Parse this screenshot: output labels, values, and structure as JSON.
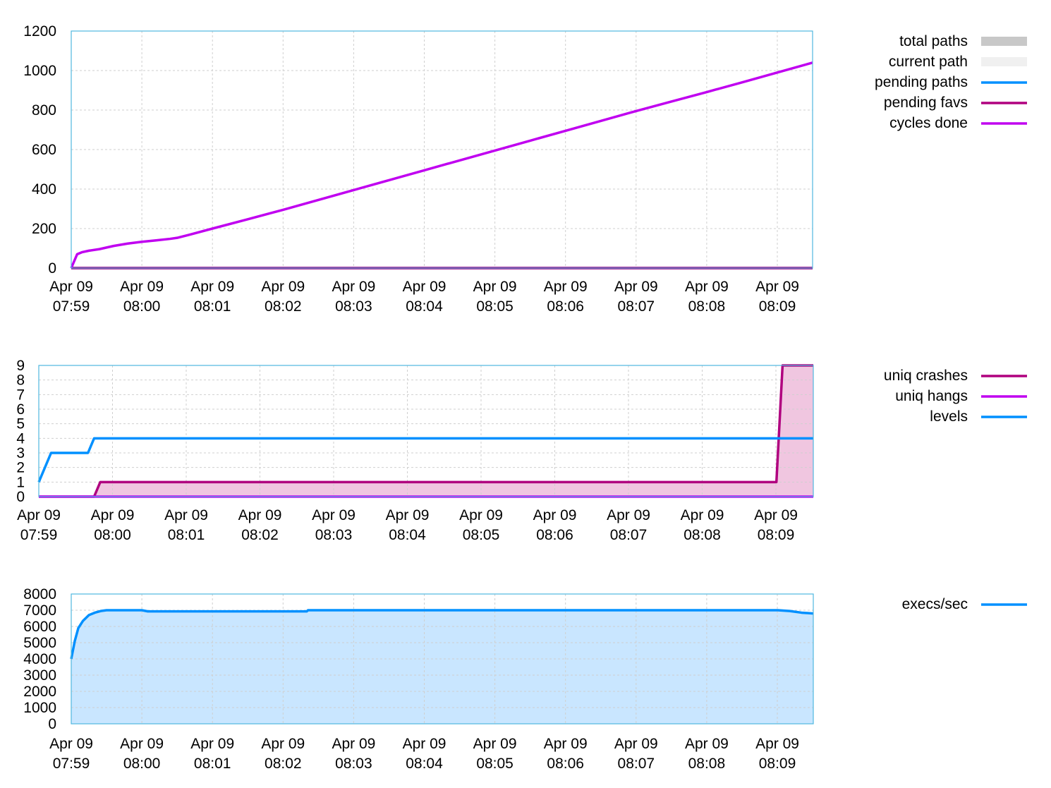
{
  "colors": {
    "frame": "#4fb8e0",
    "grid": "#cfcfcf",
    "total_paths": "#c8c8c8",
    "current_path": "#f0f0f0",
    "pending_paths": "#0090ff",
    "pending_favs": "#b0007f",
    "cycles_done": "#c000f0",
    "crash_fill": "#f0c6e0",
    "exec_fill": "#c9e6ff"
  },
  "chart_data": [
    {
      "type": "line",
      "title": "",
      "xlabel": "",
      "ylabel": "",
      "ylim": [
        0,
        1200
      ],
      "yticks": [
        "0",
        "200",
        "400",
        "600",
        "800",
        "1000",
        "1200"
      ],
      "xlim": [
        0,
        630
      ],
      "xticks": [
        {
          "date": "Apr 09",
          "time": "07:59"
        },
        {
          "date": "Apr 09",
          "time": "08:00"
        },
        {
          "date": "Apr 09",
          "time": "08:01"
        },
        {
          "date": "Apr 09",
          "time": "08:02"
        },
        {
          "date": "Apr 09",
          "time": "08:03"
        },
        {
          "date": "Apr 09",
          "time": "08:04"
        },
        {
          "date": "Apr 09",
          "time": "08:05"
        },
        {
          "date": "Apr 09",
          "time": "08:06"
        },
        {
          "date": "Apr 09",
          "time": "08:07"
        },
        {
          "date": "Apr 09",
          "time": "08:08"
        },
        {
          "date": "Apr 09",
          "time": "08:09"
        }
      ],
      "grid": true,
      "legend": "right",
      "series": [
        {
          "name": "total paths",
          "color_key": "total_paths",
          "x": [
            0,
            630
          ],
          "y": [
            0,
            0
          ]
        },
        {
          "name": "current path",
          "color_key": "current_path",
          "x": [
            0,
            630
          ],
          "y": [
            0,
            0
          ]
        },
        {
          "name": "pending paths",
          "color_key": "pending_paths",
          "x": [
            0,
            630
          ],
          "y": [
            0,
            0
          ]
        },
        {
          "name": "pending favs",
          "color_key": "pending_favs",
          "x": [
            0,
            630
          ],
          "y": [
            0,
            0
          ]
        },
        {
          "name": "cycles done",
          "color_key": "cycles_done",
          "x": [
            0,
            5,
            9,
            15,
            24,
            36,
            48,
            60,
            72,
            84,
            90,
            100,
            120,
            150,
            180,
            210,
            240,
            270,
            300,
            330,
            360,
            390,
            420,
            450,
            480,
            510,
            540,
            570,
            600,
            630
          ],
          "y": [
            0,
            70,
            80,
            88,
            96,
            112,
            124,
            133,
            140,
            148,
            153,
            168,
            200,
            247,
            295,
            345,
            395,
            445,
            495,
            545,
            595,
            645,
            695,
            745,
            795,
            843,
            891,
            940,
            990,
            1040
          ]
        }
      ]
    },
    {
      "type": "line",
      "title": "",
      "xlabel": "",
      "ylabel": "",
      "ylim": [
        0,
        9
      ],
      "yticks": [
        "0",
        "1",
        "2",
        "3",
        "4",
        "5",
        "6",
        "7",
        "8",
        "9"
      ],
      "xlim": [
        0,
        630
      ],
      "xticks": [
        {
          "date": "Apr 09",
          "time": "07:59"
        },
        {
          "date": "Apr 09",
          "time": "08:00"
        },
        {
          "date": "Apr 09",
          "time": "08:01"
        },
        {
          "date": "Apr 09",
          "time": "08:02"
        },
        {
          "date": "Apr 09",
          "time": "08:03"
        },
        {
          "date": "Apr 09",
          "time": "08:04"
        },
        {
          "date": "Apr 09",
          "time": "08:05"
        },
        {
          "date": "Apr 09",
          "time": "08:06"
        },
        {
          "date": "Apr 09",
          "time": "08:07"
        },
        {
          "date": "Apr 09",
          "time": "08:08"
        },
        {
          "date": "Apr 09",
          "time": "08:09"
        }
      ],
      "grid": true,
      "legend": "right",
      "series": [
        {
          "name": "uniq crashes",
          "color_key": "pending_favs",
          "fill": "crash_fill",
          "x": [
            0,
            45,
            50,
            600,
            605,
            630
          ],
          "y": [
            0,
            0,
            1,
            1,
            9,
            9
          ]
        },
        {
          "name": "uniq hangs",
          "color_key": "cycles_done",
          "x": [
            0,
            630
          ],
          "y": [
            0,
            0
          ]
        },
        {
          "name": "levels",
          "color_key": "pending_paths",
          "x": [
            0,
            10,
            40,
            45,
            630
          ],
          "y": [
            1,
            3,
            3,
            4,
            4
          ]
        }
      ]
    },
    {
      "type": "area",
      "title": "",
      "xlabel": "",
      "ylabel": "",
      "ylim": [
        0,
        8000
      ],
      "yticks": [
        "0",
        "1000",
        "2000",
        "3000",
        "4000",
        "5000",
        "6000",
        "7000",
        "8000"
      ],
      "xlim": [
        0,
        630
      ],
      "xticks": [
        {
          "date": "Apr 09",
          "time": "07:59"
        },
        {
          "date": "Apr 09",
          "time": "08:00"
        },
        {
          "date": "Apr 09",
          "time": "08:01"
        },
        {
          "date": "Apr 09",
          "time": "08:02"
        },
        {
          "date": "Apr 09",
          "time": "08:03"
        },
        {
          "date": "Apr 09",
          "time": "08:04"
        },
        {
          "date": "Apr 09",
          "time": "08:05"
        },
        {
          "date": "Apr 09",
          "time": "08:06"
        },
        {
          "date": "Apr 09",
          "time": "08:07"
        },
        {
          "date": "Apr 09",
          "time": "08:08"
        },
        {
          "date": "Apr 09",
          "time": "08:09"
        }
      ],
      "grid": true,
      "legend": "right",
      "series": [
        {
          "name": "execs/sec",
          "color_key": "pending_paths",
          "fill": "exec_fill",
          "x": [
            0,
            3,
            6,
            10,
            15,
            20,
            25,
            30,
            60,
            65,
            200,
            201,
            600,
            610,
            620,
            630
          ],
          "y": [
            4000,
            5100,
            5900,
            6350,
            6700,
            6850,
            6950,
            7000,
            7000,
            6930,
            6930,
            7000,
            7000,
            6950,
            6850,
            6800
          ]
        }
      ]
    }
  ]
}
